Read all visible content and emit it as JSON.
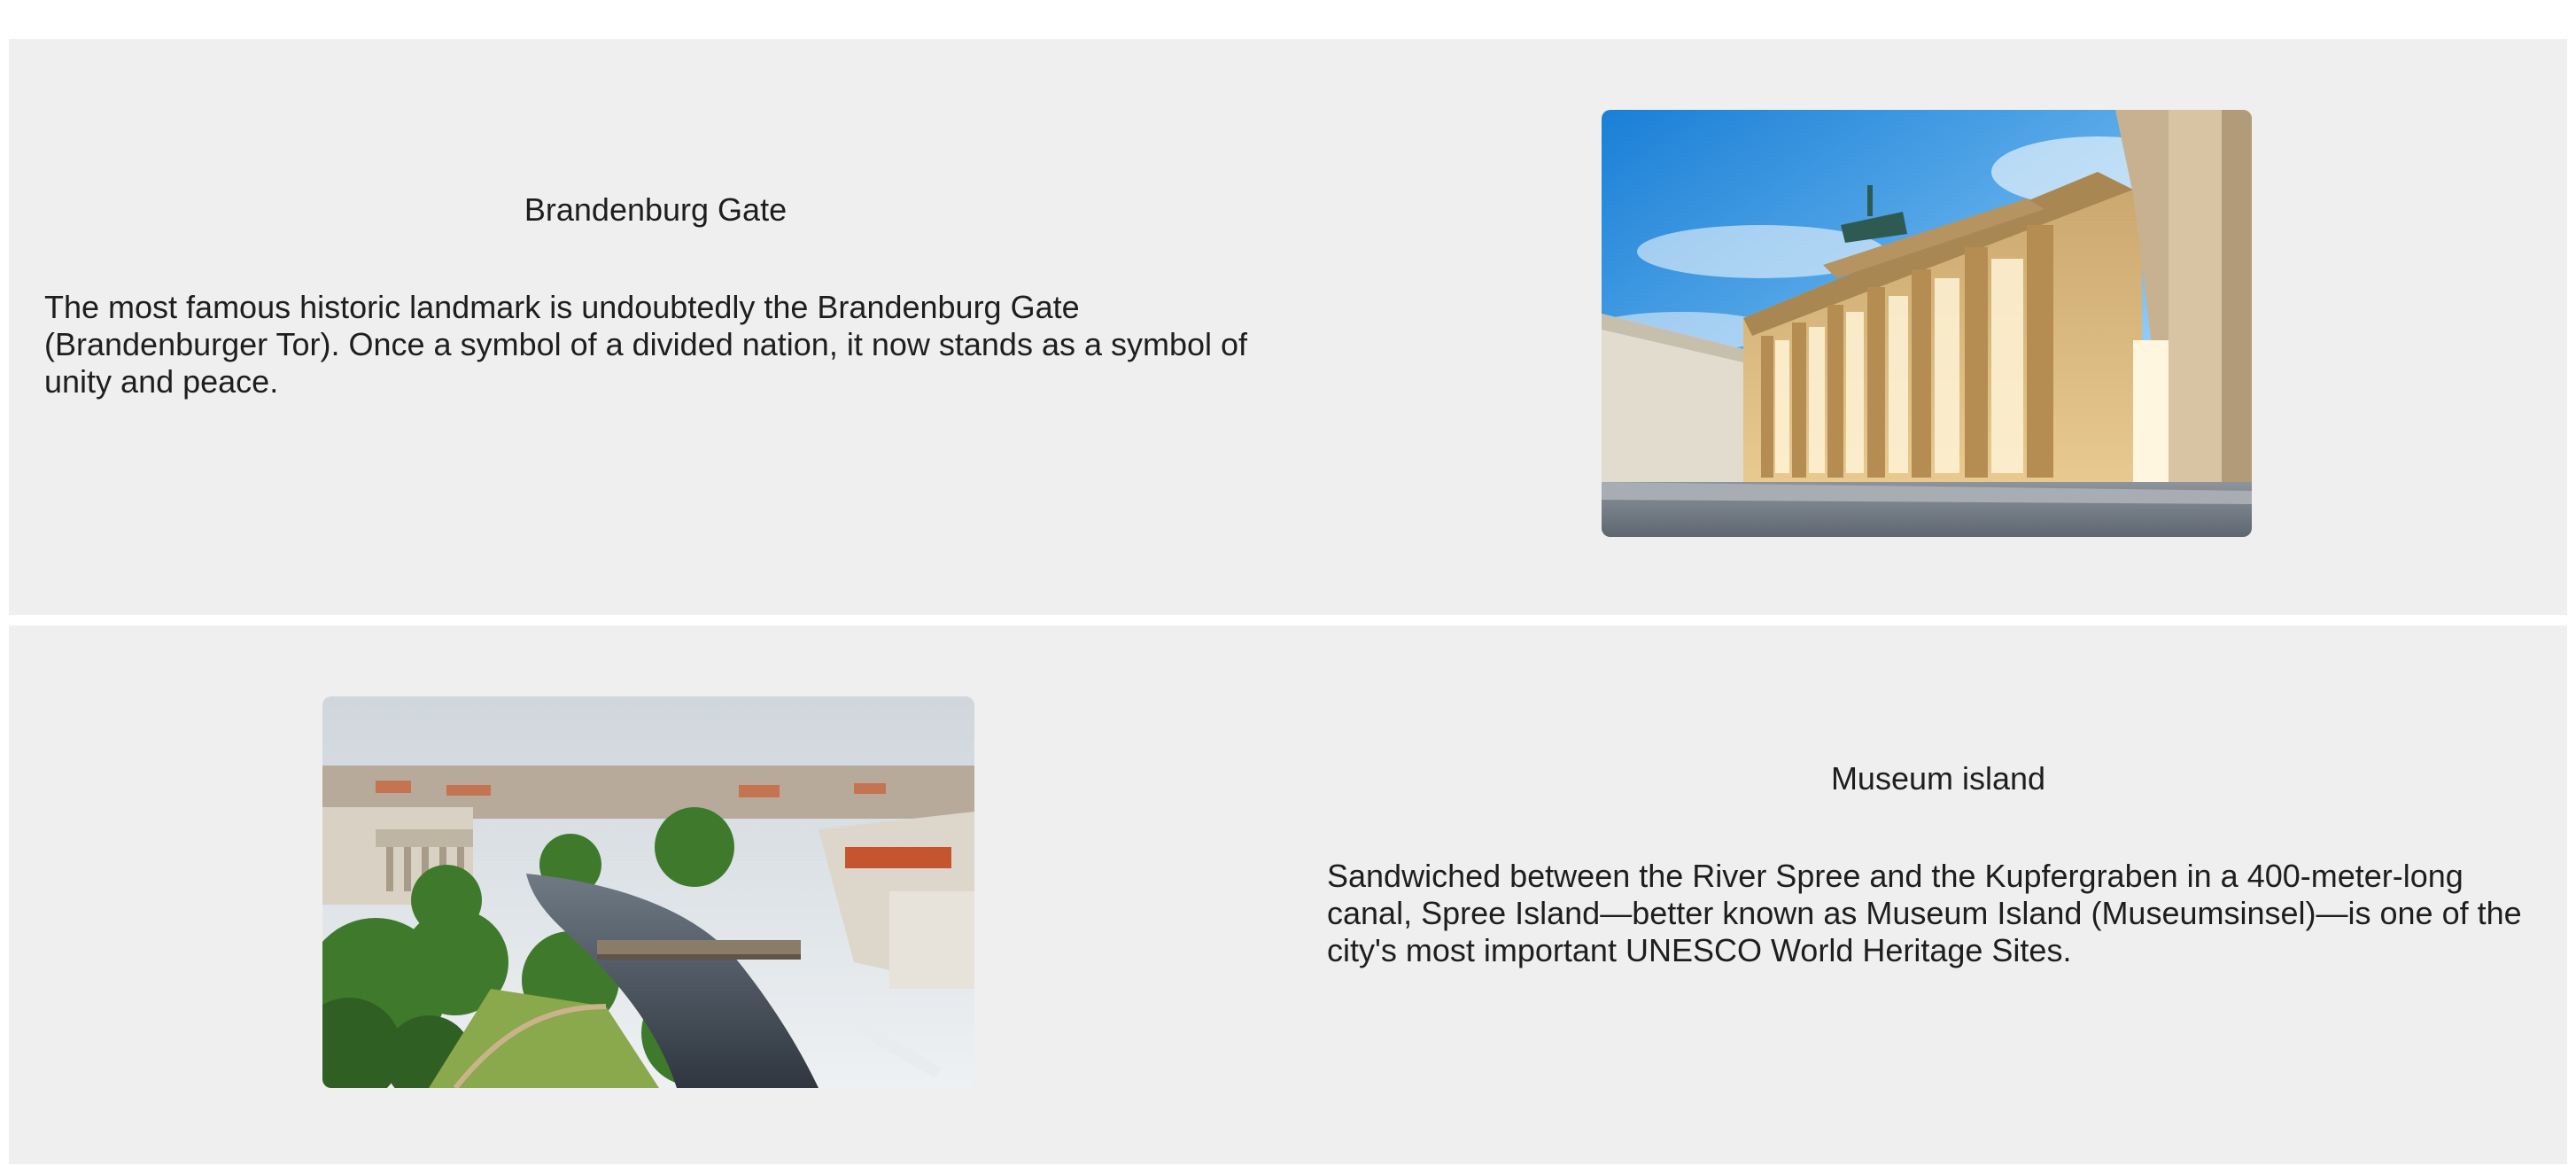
{
  "sections": [
    {
      "title": "Brandenburg Gate",
      "description": "The most famous historic landmark is undoubtedly the Brandenburg Gate (Brandenburger Tor). Once a symbol of a divided nation, it now stands as a symbol of unity and peace.",
      "image": "brandenburg-gate-photo"
    },
    {
      "title": "Museum island",
      "description": "Sandwiched between the River Spree and the Kupfergraben in a 400-meter-long canal, Spree Island—better known as Museum Island (Museumsinsel)—is one of the city's most important UNESCO World Heritage Sites.",
      "image": "museum-island-photo"
    }
  ],
  "colors": {
    "section_bg": "#efefef",
    "page_bg": "#ffffff",
    "text": "#1e1e1e"
  }
}
